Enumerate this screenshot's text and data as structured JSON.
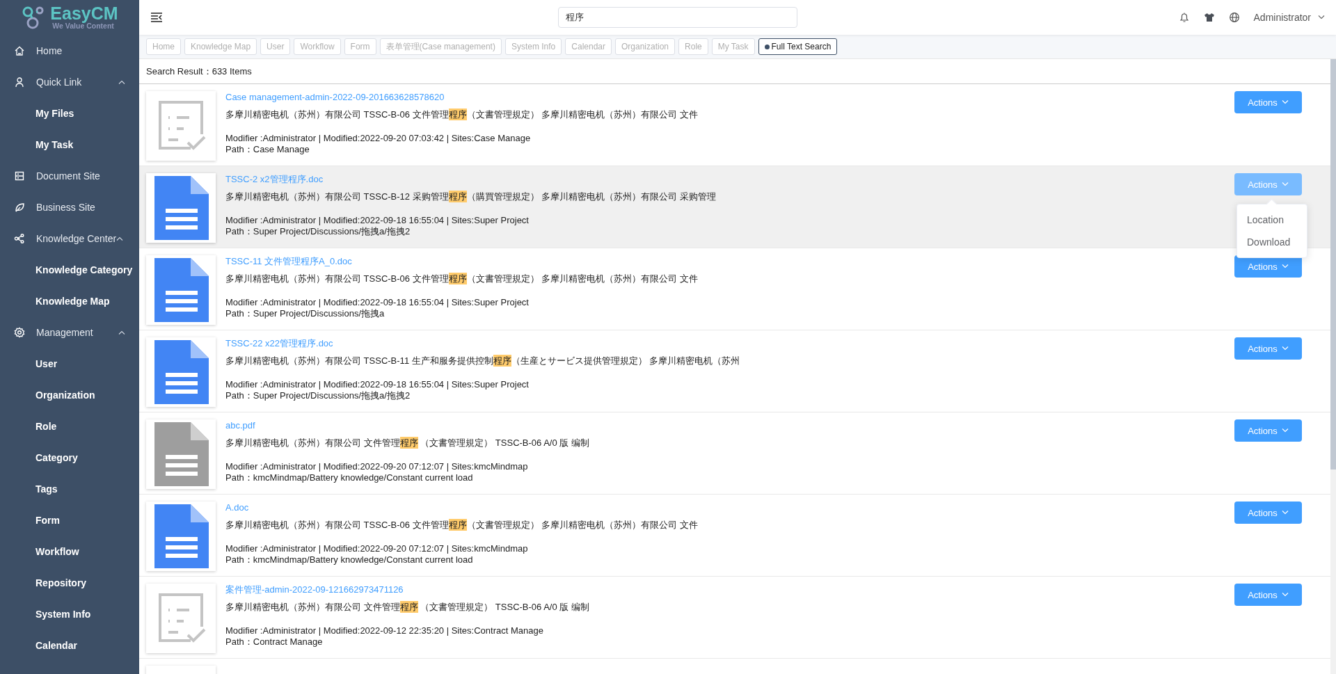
{
  "logo": {
    "name": "EasyCM",
    "tagline": "We Value Content"
  },
  "sidebar": {
    "items": [
      {
        "label": "Home"
      },
      {
        "label": "Quick Link",
        "expanded": true,
        "children": [
          {
            "label": "My Files"
          },
          {
            "label": "My Task"
          }
        ]
      },
      {
        "label": "Document Site"
      },
      {
        "label": "Business Site"
      },
      {
        "label": "Knowledge Center",
        "expanded": true,
        "children": [
          {
            "label": "Knowledge Category"
          },
          {
            "label": "Knowledge Map"
          }
        ]
      },
      {
        "label": "Management",
        "expanded": true,
        "children": [
          {
            "label": "User"
          },
          {
            "label": "Organization"
          },
          {
            "label": "Role"
          },
          {
            "label": "Category"
          },
          {
            "label": "Tags"
          },
          {
            "label": "Form"
          },
          {
            "label": "Workflow"
          },
          {
            "label": "Repository"
          },
          {
            "label": "System Info"
          },
          {
            "label": "Calendar"
          }
        ]
      }
    ]
  },
  "header": {
    "search": {
      "value": "程序"
    },
    "user": "Administrator"
  },
  "tabs": [
    {
      "label": "Home",
      "selected": false
    },
    {
      "label": "Knowledge Map",
      "selected": false
    },
    {
      "label": "User",
      "selected": false
    },
    {
      "label": "Workflow",
      "selected": false
    },
    {
      "label": "Form",
      "selected": false
    },
    {
      "label": "表单管理(Case management)",
      "selected": false
    },
    {
      "label": "System Info",
      "selected": false
    },
    {
      "label": "Calendar",
      "selected": false
    },
    {
      "label": "Organization",
      "selected": false
    },
    {
      "label": "Role",
      "selected": false
    },
    {
      "label": "My Task",
      "selected": false
    },
    {
      "label": "Full Text Search",
      "selected": true
    }
  ],
  "search_result": "Search Result：633 Items",
  "results": [
    {
      "kind": "form",
      "title": "Case management-admin-2022-09-201663628578620",
      "snippet": {
        "before": "多摩川精密电机（苏州）有限公司 TSSC-B-06 文件管理",
        "match": "程序",
        "after": "（文書管理規定） 多摩川精密电机（苏州）有限公司 文件"
      },
      "meta": "Modifier :Administrator | Modified:2022-09-20 07:03:42 | Sites:Case Manage",
      "path": "Path：Case Manage",
      "selected": false,
      "action": "Actions",
      "menu_open": false
    },
    {
      "kind": "doc",
      "title": "TSSC-2 x2管理程序.doc",
      "snippet": {
        "before": "多摩川精密电机（苏州）有限公司 TSSC-B-12 采购管理",
        "match": "程序",
        "after": "（購買管理規定） 多摩川精密电机（苏州）有限公司 采购管理"
      },
      "meta": "Modifier :Administrator | Modified:2022-09-18 16:55:04 | Sites:Super Project",
      "path": "Path：Super Project/Discussions/拖拽a/拖拽2",
      "selected": true,
      "action": "Actions",
      "menu_open": true,
      "menu": [
        "Location",
        "Download"
      ]
    },
    {
      "kind": "doc",
      "title": "TSSC-11 文件管理程序A_0.doc",
      "snippet": {
        "before": "多摩川精密电机（苏州）有限公司 TSSC-B-06 文件管理",
        "match": "程序",
        "after": "（文書管理規定） 多摩川精密电机（苏州）有限公司 文件"
      },
      "meta": "Modifier :Administrator | Modified:2022-09-18 16:55:04 | Sites:Super Project",
      "path": "Path：Super Project/Discussions/拖拽a",
      "selected": false,
      "action": "Actions",
      "menu_open": false
    },
    {
      "kind": "doc",
      "title": "TSSC-22 x22管理程序.doc",
      "snippet": {
        "before": "多摩川精密电机（苏州）有限公司 TSSC-B-11 生产和服务提供控制",
        "match": "程序",
        "after": "（生産とサービス提供管理規定） 多摩川精密电机（苏州"
      },
      "meta": "Modifier :Administrator | Modified:2022-09-18 16:55:04 | Sites:Super Project",
      "path": "Path：Super Project/Discussions/拖拽a/拖拽2",
      "selected": false,
      "action": "Actions",
      "menu_open": false
    },
    {
      "kind": "pdf",
      "title": "abc.pdf",
      "snippet": {
        "before": "多摩川精密电机（苏州）有限公司 文件管理",
        "match": "程序",
        "after": " （文書管理規定） TSSC-B-06 A/0 版 编制"
      },
      "meta": "Modifier :Administrator | Modified:2022-09-20 07:12:07 | Sites:kmcMindmap",
      "path": "Path：kmcMindmap/Battery knowledge/Constant current load",
      "selected": false,
      "action": "Actions",
      "menu_open": false
    },
    {
      "kind": "doc",
      "title": "A.doc",
      "snippet": {
        "before": "多摩川精密电机（苏州）有限公司 TSSC-B-06 文件管理",
        "match": "程序",
        "after": "（文書管理規定） 多摩川精密电机（苏州）有限公司 文件"
      },
      "meta": "Modifier :Administrator | Modified:2022-09-20 07:12:07 | Sites:kmcMindmap",
      "path": "Path：kmcMindmap/Battery knowledge/Constant current load",
      "selected": false,
      "action": "Actions",
      "menu_open": false
    },
    {
      "kind": "form",
      "title": "案件管理-admin-2022-09-121662973471126",
      "snippet": {
        "before": "多摩川精密电机（苏州）有限公司 文件管理",
        "match": "程序",
        "after": " （文書管理規定） TSSC-B-06 A/0 版 编制"
      },
      "meta": "Modifier :Administrator | Modified:2022-09-12 22:35:20 | Sites:Contract Manage",
      "path": "Path：Contract Manage",
      "selected": false,
      "action": "Actions",
      "menu_open": false
    },
    {
      "kind": "form",
      "selected": false
    }
  ]
}
